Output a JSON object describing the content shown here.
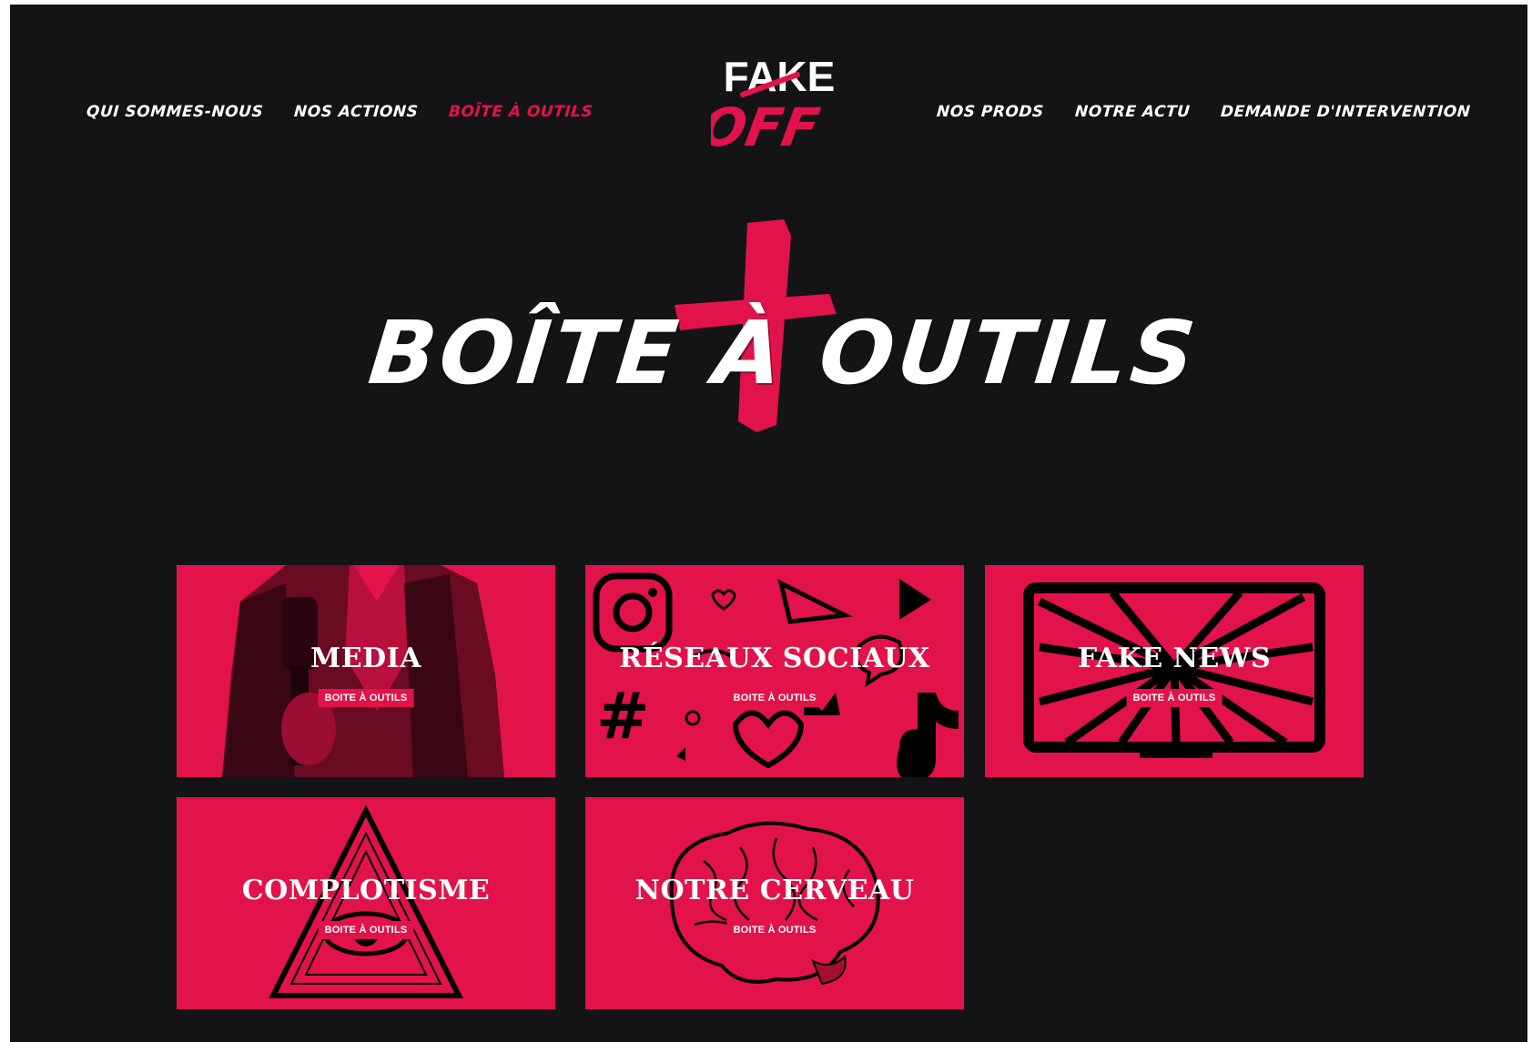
{
  "nav": {
    "left": [
      {
        "label": "QUI SOMMES-NOUS"
      },
      {
        "label": "NOS ACTIONS"
      },
      {
        "label": "BOÎTE À OUTILS"
      }
    ],
    "right": [
      {
        "label": "NOS PRODS"
      },
      {
        "label": "NOTRE ACTU"
      },
      {
        "label": "DEMANDE D'INTERVENTION"
      }
    ]
  },
  "logo": {
    "top_text": "FAKE",
    "bottom_text": "OFF"
  },
  "hero": {
    "title": "BOÎTE À OUTILS"
  },
  "tiles": [
    {
      "title": "MEDIA",
      "badge": "BOITE À OUTILS",
      "icon": "journalist-microphone"
    },
    {
      "title": "RÉSEAUX SOCIAUX",
      "badge": "BOITE À OUTILS",
      "icon": "social-media-icons"
    },
    {
      "title": "FAKE NEWS",
      "badge": "BOITE À OUTILS",
      "icon": "tv-hypnotic-screen"
    },
    {
      "title": "COMPLOTISME",
      "badge": "BOITE À OUTILS",
      "icon": "illuminati-eye-pyramid"
    },
    {
      "title": "NOTRE CERVEAU",
      "badge": "BOITE À OUTILS",
      "icon": "brain"
    }
  ],
  "colors": {
    "accent": "#e2134a",
    "background": "#141416",
    "text": "#ffffff"
  }
}
